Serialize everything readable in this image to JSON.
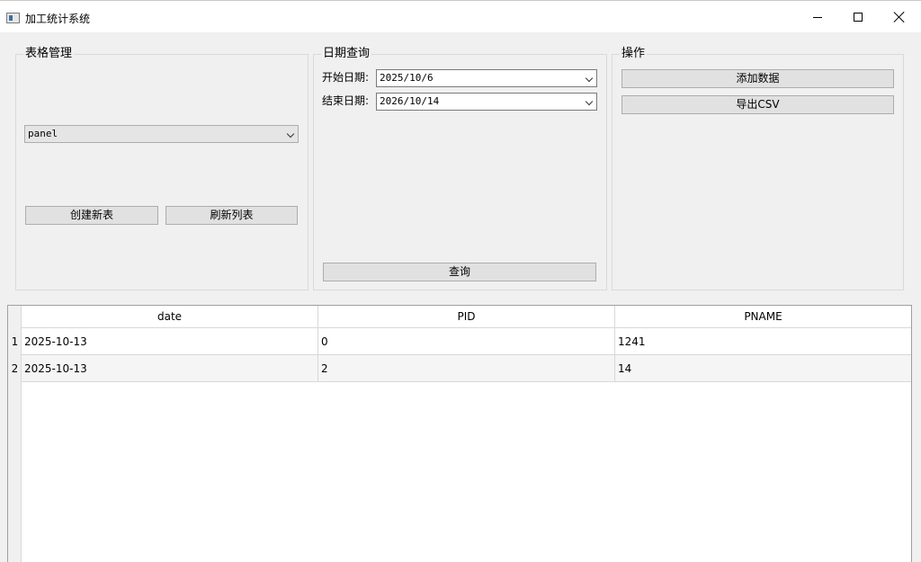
{
  "window": {
    "title": "加工统计系统",
    "controls": [
      "minimize-icon",
      "maximize-icon",
      "close-icon"
    ]
  },
  "table_management": {
    "title": "表格管理",
    "table_select": "panel",
    "create_button": "创建新表",
    "refresh_button": "刷新列表"
  },
  "date_query": {
    "title": "日期查询",
    "start_label": "开始日期:",
    "start_value": "2025/10/6",
    "end_label": "结束日期:",
    "end_value": "2026/10/14",
    "query_button": "查询"
  },
  "operations": {
    "title": "操作",
    "add_button": "添加数据",
    "export_button": "导出CSV"
  },
  "table": {
    "columns": [
      "date",
      "PID",
      "PNAME"
    ],
    "rows": [
      {
        "num": "1",
        "date": "2025-10-13",
        "pid": "0",
        "pname": "1241"
      },
      {
        "num": "2",
        "date": "2025-10-13",
        "pid": "2",
        "pname": "14"
      }
    ]
  }
}
